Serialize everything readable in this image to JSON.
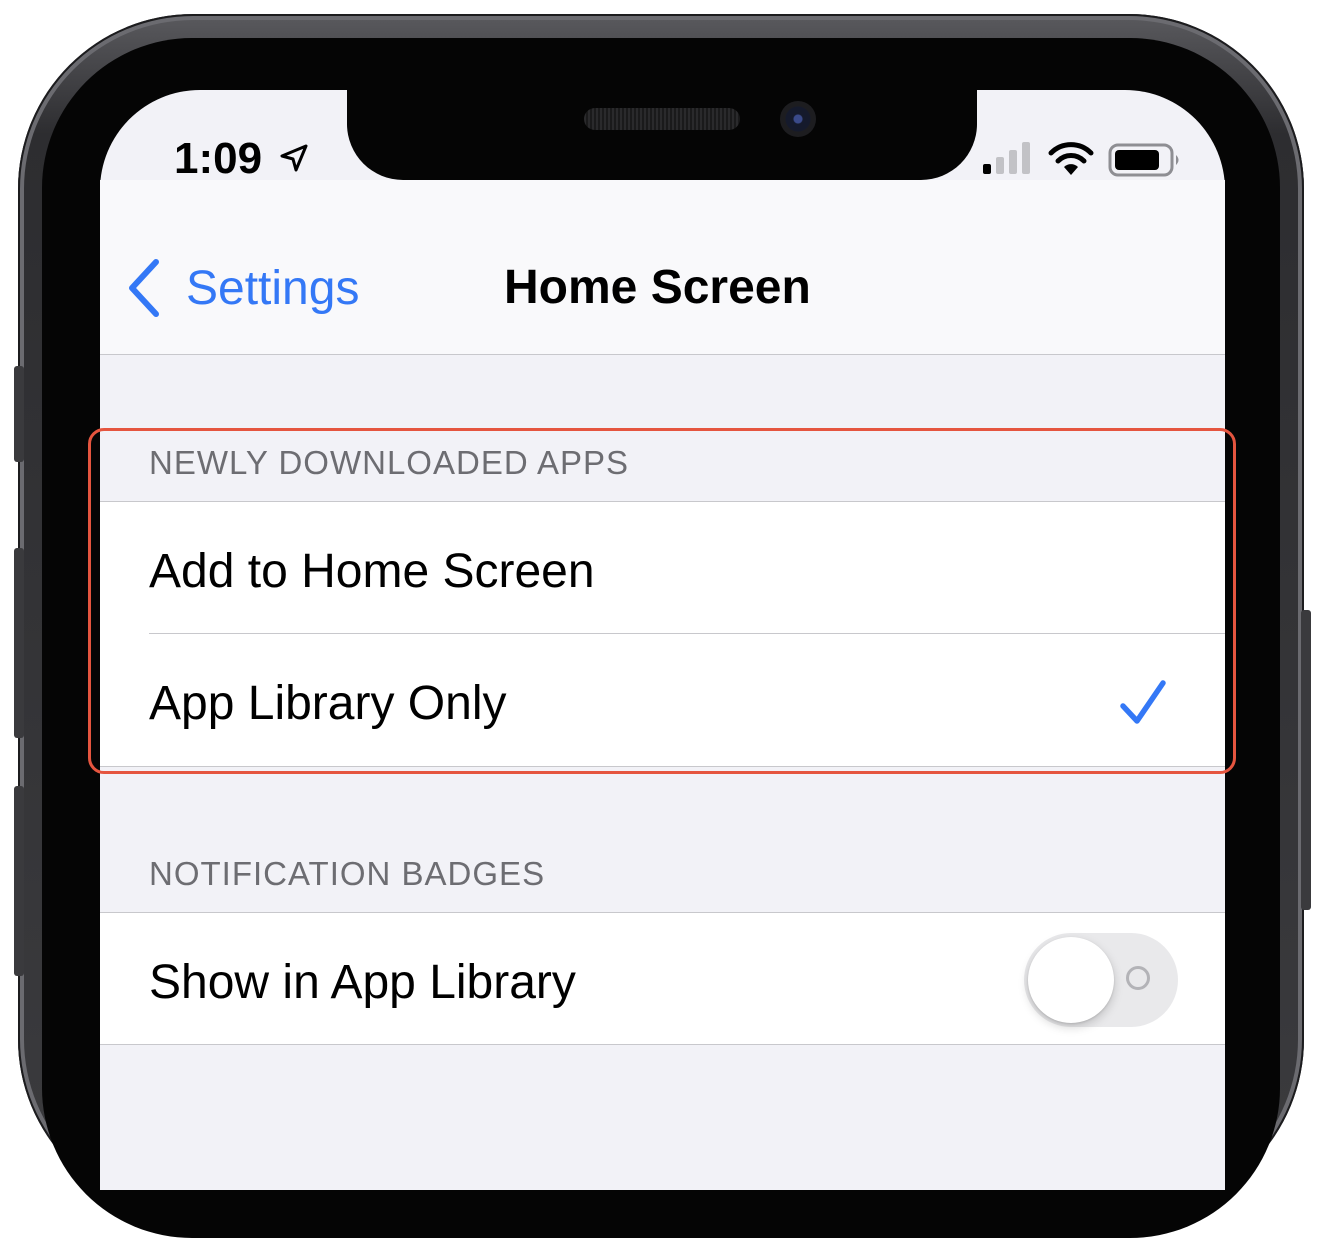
{
  "status_bar": {
    "time": "1:09",
    "location_icon": "location-arrow-icon",
    "signal_icon": "cellular-signal-icon",
    "wifi_icon": "wifi-icon",
    "battery_icon": "battery-icon"
  },
  "nav": {
    "back_label": "Settings",
    "back_icon": "chevron-left-icon",
    "title": "Home Screen"
  },
  "newly_downloaded": {
    "header": "NEWLY DOWNLOADED APPS",
    "options": [
      {
        "label": "Add to Home Screen",
        "selected": false
      },
      {
        "label": "App Library Only",
        "selected": true
      }
    ]
  },
  "notification_badges": {
    "header": "NOTIFICATION BADGES",
    "rows": [
      {
        "label": "Show in App Library",
        "toggle_on": false
      }
    ]
  },
  "colors": {
    "accent": "#3478f6",
    "highlight": "#e5553f",
    "grouped_background": "#f2f2f7"
  }
}
